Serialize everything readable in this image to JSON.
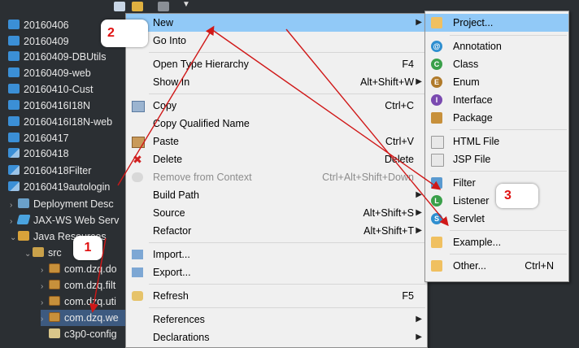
{
  "tree": {
    "items": [
      {
        "label": "20160406"
      },
      {
        "label": "20160409"
      },
      {
        "label": "20160409-DBUtils"
      },
      {
        "label": "20160409-web"
      },
      {
        "label": "20160410-Cust"
      },
      {
        "label": "20160416I18N"
      },
      {
        "label": "20160416I18N-web"
      },
      {
        "label": "20160417"
      },
      {
        "label": "20160418"
      },
      {
        "label": "20160418Filter"
      },
      {
        "label": "20160419autologin"
      },
      {
        "label": "Deployment Desc"
      },
      {
        "label": "JAX-WS Web Serv"
      },
      {
        "label": "Java Resources"
      },
      {
        "label": "src"
      },
      {
        "label": "com.dzq.do"
      },
      {
        "label": "com.dzq.filt"
      },
      {
        "label": "com.dzq.uti"
      },
      {
        "label": "com.dzq.we"
      },
      {
        "label": "c3p0-config"
      }
    ]
  },
  "menu": {
    "items": [
      {
        "label": "New",
        "shortcut": ""
      },
      {
        "label": "Go Into",
        "shortcut": ""
      },
      {
        "label": "Open Type Hierarchy",
        "shortcut": "F4"
      },
      {
        "label": "Show In",
        "shortcut": "Alt+Shift+W"
      },
      {
        "label": "Copy",
        "shortcut": "Ctrl+C"
      },
      {
        "label": "Copy Qualified Name",
        "shortcut": ""
      },
      {
        "label": "Paste",
        "shortcut": "Ctrl+V"
      },
      {
        "label": "Delete",
        "shortcut": "Delete"
      },
      {
        "label": "Remove from Context",
        "shortcut": "Ctrl+Alt+Shift+Down"
      },
      {
        "label": "Build Path",
        "shortcut": ""
      },
      {
        "label": "Source",
        "shortcut": "Alt+Shift+S"
      },
      {
        "label": "Refactor",
        "shortcut": "Alt+Shift+T"
      },
      {
        "label": "Import...",
        "shortcut": ""
      },
      {
        "label": "Export...",
        "shortcut": ""
      },
      {
        "label": "Refresh",
        "shortcut": "F5"
      },
      {
        "label": "References",
        "shortcut": ""
      },
      {
        "label": "Declarations",
        "shortcut": ""
      }
    ]
  },
  "submenu": {
    "items": [
      {
        "label": "Project...",
        "shortcut": ""
      },
      {
        "label": "Annotation",
        "shortcut": ""
      },
      {
        "label": "Class",
        "shortcut": ""
      },
      {
        "label": "Enum",
        "shortcut": ""
      },
      {
        "label": "Interface",
        "shortcut": ""
      },
      {
        "label": "Package",
        "shortcut": ""
      },
      {
        "label": "HTML File",
        "shortcut": ""
      },
      {
        "label": "JSP File",
        "shortcut": ""
      },
      {
        "label": "Filter",
        "shortcut": ""
      },
      {
        "label": "Listener",
        "shortcut": ""
      },
      {
        "label": "Servlet",
        "shortcut": ""
      },
      {
        "label": "Example...",
        "shortcut": ""
      },
      {
        "label": "Other...",
        "shortcut": "Ctrl+N"
      }
    ]
  },
  "annotations": {
    "step1": "1",
    "step2": "2",
    "step3": "3"
  },
  "colors": {
    "highlight": "#91c9f7",
    "arrow": "#d01818",
    "tree_bg": "#2b2f33",
    "menu_bg": "#f0f0f0"
  }
}
